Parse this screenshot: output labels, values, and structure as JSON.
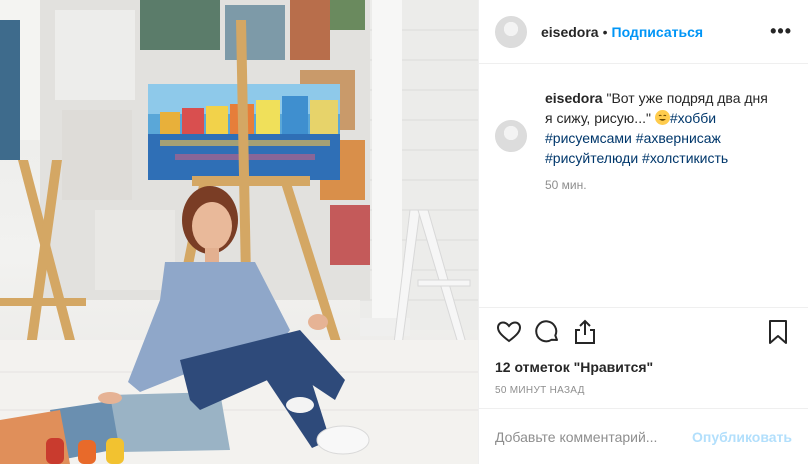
{
  "post": {
    "username": "eisedora",
    "separator": "•",
    "follow_label": "Подписаться",
    "more_label": "•••",
    "caption": {
      "username": "eisedora",
      "text": "\"Вот уже подряд два дня я сижу, рисую...\"",
      "hashtags": [
        "#хобби",
        "#рисуемсами",
        "#ахвернисаж",
        "#рисуйтелюди",
        "#холстикисть"
      ]
    },
    "caption_time": "50 мин.",
    "likes_text": "12 отметок \"Нравится\"",
    "posted_ago": "50 МИНУТ НАЗАД",
    "comment_placeholder": "Добавьте комментарий...",
    "publish_label": "Опубликовать"
  },
  "icons": [
    "heart-icon",
    "comment-icon",
    "share-icon",
    "bookmark-icon",
    "emoji-icon"
  ],
  "colors": {
    "accent": "#0095f6",
    "hashtag": "#00376b",
    "muted": "#8e8e8e",
    "publish_disabled": "#b2dffc"
  }
}
